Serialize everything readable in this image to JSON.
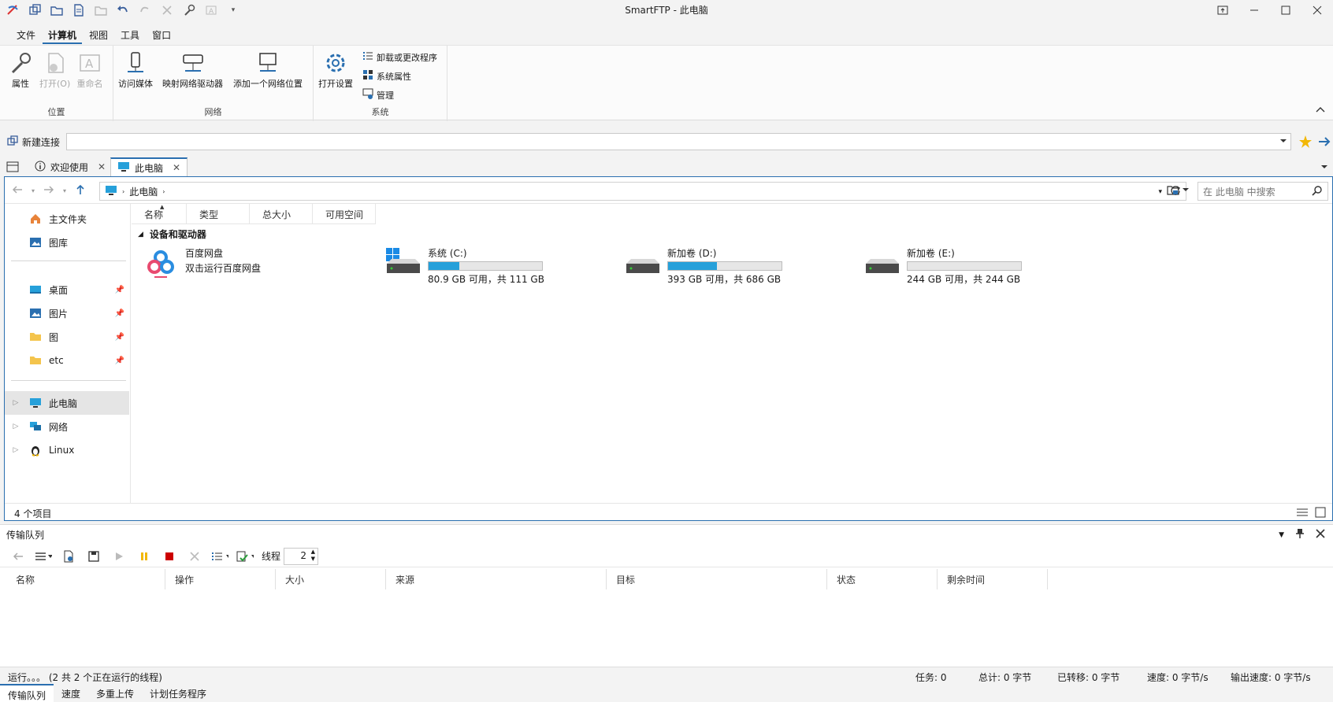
{
  "window": {
    "title": "SmartFTP - 此电脑"
  },
  "menu": {
    "items": [
      "文件",
      "计算机",
      "视图",
      "工具",
      "窗口"
    ],
    "active_index": 1
  },
  "ribbon": {
    "groups": {
      "location": "位置",
      "network": "网络",
      "system": "系统"
    },
    "buttons": {
      "properties": "属性",
      "open": "打开(O)",
      "rename": "重命名",
      "access_media": "访问媒体",
      "map_drive": "映射网络驱动器",
      "add_location": "添加一个网络位置",
      "open_settings": "打开设置",
      "uninstall": "卸载或更改程序",
      "sys_props": "系统属性",
      "manage": "管理"
    }
  },
  "connection": {
    "label": "新建连接",
    "address_value": ""
  },
  "tabs": [
    {
      "label": "欢迎使用",
      "active": false
    },
    {
      "label": "此电脑",
      "active": true
    }
  ],
  "explorer": {
    "breadcrumb": [
      "此电脑"
    ],
    "search_placeholder": "在 此电脑 中搜索",
    "sidebar": {
      "top": [
        {
          "label": "主文件夹",
          "icon": "home-icon"
        },
        {
          "label": "图库",
          "icon": "gallery-icon"
        }
      ],
      "pinned": [
        {
          "label": "桌面",
          "icon": "desktop-icon"
        },
        {
          "label": "图片",
          "icon": "pictures-icon"
        },
        {
          "label": "图",
          "icon": "folder-icon"
        },
        {
          "label": "etc",
          "icon": "folder-icon"
        }
      ],
      "locations": [
        {
          "label": "此电脑",
          "icon": "computer-icon"
        },
        {
          "label": "网络",
          "icon": "network-icon"
        },
        {
          "label": "Linux",
          "icon": "linux-icon"
        }
      ]
    },
    "columns": [
      "名称",
      "类型",
      "总大小",
      "可用空间"
    ],
    "group_header": "设备和驱动器",
    "app": {
      "name": "百度网盘",
      "desc": "双击运行百度网盘"
    },
    "drives": [
      {
        "name": "系统 (C:)",
        "info": "80.9 GB 可用，共 111 GB",
        "used_fraction": 0.27,
        "windows": true
      },
      {
        "name": "新加卷 (D:)",
        "info": "393 GB 可用，共 686 GB",
        "used_fraction": 0.43,
        "windows": false
      },
      {
        "name": "新加卷 (E:)",
        "info": "244 GB 可用，共 244 GB",
        "used_fraction": 0.0,
        "windows": false
      }
    ],
    "status": "4 个项目"
  },
  "queue": {
    "title": "传输队列",
    "threads_label": "线程",
    "threads_value": "2",
    "columns": [
      "名称",
      "操作",
      "大小",
      "来源",
      "目标",
      "状态",
      "剩余时间"
    ],
    "status_left": "运行。。。  (2 共 2 个正在运行的线程)",
    "stats": [
      "任务: 0",
      "总计: 0 字节",
      "已转移: 0 字节",
      "速度: 0 字节/s",
      "输出速度: 0 字节/s"
    ],
    "bottom_tabs": [
      "传输队列",
      "速度",
      "多重上传",
      "计划任务程序"
    ]
  },
  "colors": {
    "accent": "#2a6fb0",
    "bar_fill": "#26a0da",
    "drive_bar_bg": "#e6e6e6"
  }
}
